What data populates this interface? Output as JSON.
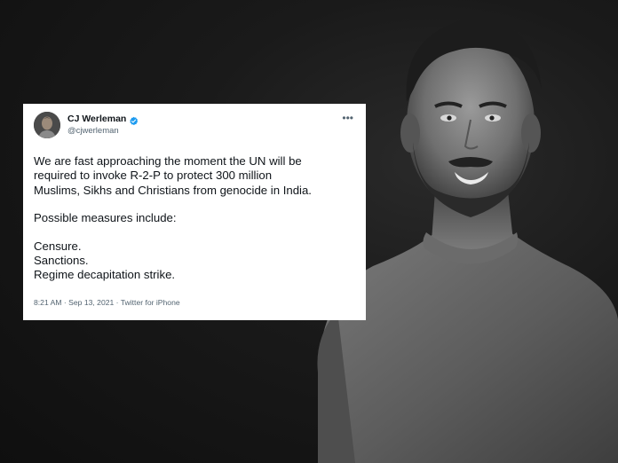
{
  "tweet": {
    "display_name": "CJ Werleman",
    "handle": "@cjwerleman",
    "more_label": "•••",
    "lines_para1": [
      "We are fast approaching the moment  the UN will be",
      "required to invoke R-2-P to protect 300 million",
      "Muslims, Sikhs and Christians from genocide in India."
    ],
    "line_para2": "Possible measures include:",
    "lines_para3": [
      "Censure.",
      "Sanctions.",
      "Regime decapitation strike."
    ],
    "meta": "8:21 AM · Sep 13, 2021 · Twitter for iPhone"
  },
  "icons": {
    "verified": "verified-badge-icon",
    "more": "more-options-icon"
  },
  "colors": {
    "background": "#141414",
    "card": "#ffffff",
    "verified_blue": "#1d9bf0",
    "text": "#0f1419",
    "secondary_text": "#536471"
  }
}
